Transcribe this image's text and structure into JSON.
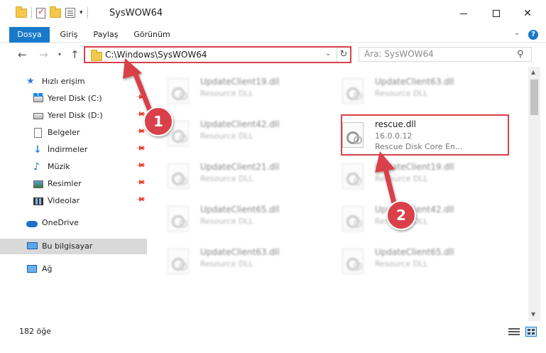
{
  "window": {
    "title": "SysWOW64"
  },
  "ribbon": {
    "tabs": [
      {
        "label": "Dosya"
      },
      {
        "label": "Giriş"
      },
      {
        "label": "Paylaş"
      },
      {
        "label": "Görünüm"
      }
    ]
  },
  "address": {
    "path": "C:\\Windows\\SysWOW64"
  },
  "search": {
    "placeholder": "Ara: SysWOW64"
  },
  "sidebar": {
    "items": [
      {
        "label": "Hızlı erişim",
        "icon": "star-icon"
      },
      {
        "label": "Yerel Disk (C:)",
        "icon": "drive-icon",
        "pinned": true
      },
      {
        "label": "Yerel Disk (D:)",
        "icon": "drive-icon",
        "pinned": true
      },
      {
        "label": "Belgeler",
        "icon": "documents-icon",
        "pinned": true
      },
      {
        "label": "İndirmeler",
        "icon": "download-icon",
        "pinned": true
      },
      {
        "label": "Müzik",
        "icon": "music-icon",
        "pinned": true
      },
      {
        "label": "Resimler",
        "icon": "pictures-icon",
        "pinned": true
      },
      {
        "label": "Videolar",
        "icon": "videos-icon",
        "pinned": true
      },
      {
        "label": "OneDrive",
        "icon": "onedrive-icon"
      },
      {
        "label": "Bu bilgisayar",
        "icon": "computer-icon",
        "selected": true
      },
      {
        "label": "Ağ",
        "icon": "network-icon"
      }
    ]
  },
  "files": {
    "col1": [
      {
        "name": "UpdateClient19.dll",
        "type": "Resource DLL"
      },
      {
        "name": "UpdateClient42.dll",
        "type": "Resource DLL"
      },
      {
        "name": "UpdateClient21.dll",
        "type": "Resource DLL"
      },
      {
        "name": "UpdateClient65.dll",
        "type": "Resource DLL"
      },
      {
        "name": "UpdateClient63.dll",
        "type": "Resource DLL"
      }
    ],
    "col2": [
      {
        "name": "UpdateClient63.dll",
        "type": "Resource DLL"
      },
      {
        "name": "rescue.dll",
        "version": "16.0.0.12",
        "type": "Rescue Disk Core En..."
      },
      {
        "name": "UpdateClient19.dll",
        "type": "Resource DLL"
      },
      {
        "name": "UpdateClient42.dll",
        "type": "Resource DLL"
      },
      {
        "name": "UpdateClient65.dll",
        "type": "Resource DLL"
      }
    ]
  },
  "status": {
    "count": "182 öğe"
  },
  "annotations": {
    "badge1": "1",
    "badge2": "2",
    "color": "#d9414a"
  }
}
